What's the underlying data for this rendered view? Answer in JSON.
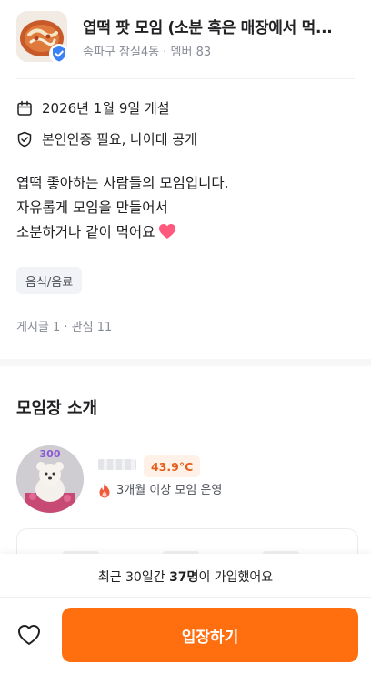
{
  "header": {
    "title": "엽떡 팟 모임 (소분 혹은 매장에서 먹...",
    "subtitle": "송파구 잠실4동 · 멤버 83",
    "thumbnail_icon": "food-thumbnail",
    "verified_icon": "verified-badge-icon"
  },
  "info": {
    "date": "2026년 1월 9일 개설",
    "requirements": "본인인증 필요, 나이대 공개"
  },
  "description": {
    "lines": [
      "엽떡 좋아하는 사람들의 모임입니다.",
      "자유롭게 모임을 만들어서",
      "소분하거나 같이 먹어요"
    ],
    "emoji_icon": "heart-emoji"
  },
  "tag": "음식/음료",
  "stats": "게시글 1 · 관심 11",
  "host": {
    "section_title": "모임장 소개",
    "temperature": "43.9°C",
    "desc": "3개월 이상 모임 운영",
    "avatar_badge": "300"
  },
  "bottom": {
    "join_prefix": "최근 30일간 ",
    "join_count": "37명",
    "join_suffix": "이 가입했어요",
    "cta_label": "입장하기"
  },
  "colors": {
    "accent": "#ff6f0f",
    "verified": "#3b82f6",
    "temperature_bg": "#fff1e8",
    "temperature_text": "#e55e1b",
    "heart": "#ff5a7d"
  }
}
